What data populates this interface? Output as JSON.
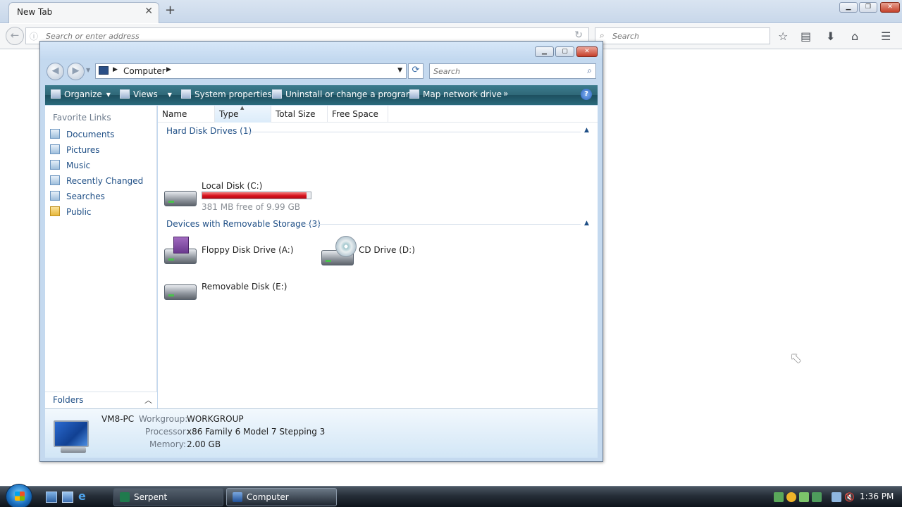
{
  "browser": {
    "tab_title": "New Tab",
    "tab_close": "✕",
    "new_tab": "+",
    "url_placeholder": "Search or enter address",
    "search_placeholder": "Search",
    "window_controls": {
      "min": "▁",
      "max": "❐",
      "close": "✕"
    }
  },
  "explorer": {
    "window_controls": {
      "min": "▁",
      "max": "▢",
      "close": "✕"
    },
    "address": {
      "location": "Computer",
      "arrow": "▶",
      "dropdown": "▼"
    },
    "search_placeholder": "Search",
    "command_bar": {
      "organize": "Organize",
      "views": "Views",
      "system_properties": "System properties",
      "uninstall": "Uninstall or change a program",
      "map_drive": "Map network drive",
      "more": "»",
      "help": "?"
    },
    "nav_pane": {
      "title": "Favorite Links",
      "items": [
        {
          "label": "Documents",
          "icon": "documents-icon"
        },
        {
          "label": "Pictures",
          "icon": "pictures-icon"
        },
        {
          "label": "Music",
          "icon": "music-icon"
        },
        {
          "label": "Recently Changed",
          "icon": "recent-icon"
        },
        {
          "label": "Searches",
          "icon": "searches-icon"
        },
        {
          "label": "Public",
          "icon": "public-folder-icon"
        }
      ],
      "folders_label": "Folders"
    },
    "columns": [
      "Name",
      "Type",
      "Total Size",
      "Free Space"
    ],
    "groups": [
      {
        "title": "Hard Disk Drives (1)",
        "items": [
          {
            "name": "Local Disk (C:)",
            "free_text": "381 MB free of 9.99 GB",
            "used_fraction": 0.963
          }
        ]
      },
      {
        "title": "Devices with Removable Storage (3)",
        "items": [
          {
            "name": "Floppy Disk Drive (A:)"
          },
          {
            "name": "CD Drive (D:)"
          },
          {
            "name": "Removable Disk (E:)"
          }
        ]
      }
    ],
    "details": {
      "computer_name": "VM8-PC",
      "workgroup_label": "Workgroup:",
      "workgroup": "WORKGROUP",
      "processor_label": "Processor:",
      "processor": "x86 Family 6 Model 7 Stepping 3",
      "memory_label": "Memory:",
      "memory": "2.00 GB"
    }
  },
  "taskbar": {
    "buttons": [
      {
        "label": "Serpent",
        "icon": "serpent-app-icon"
      },
      {
        "label": "Computer",
        "icon": "computer-icon"
      }
    ],
    "clock": "1:36 PM"
  }
}
